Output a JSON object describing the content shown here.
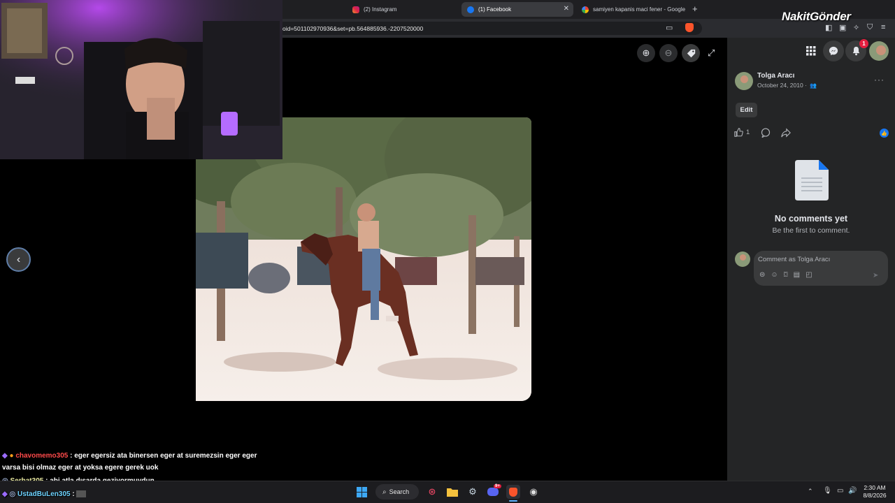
{
  "browser": {
    "tabs": [
      {
        "title": "(2) Instagram",
        "icon": "instagram-icon",
        "active": false
      },
      {
        "title": "(1) Facebook",
        "icon": "facebook-icon",
        "active": true
      },
      {
        "title": "samiyen kapanis maci fener - Google",
        "icon": "google-icon",
        "active": false
      }
    ],
    "new_tab": "+",
    "url": "oid=501102970936&set=pb.564885936.-2207520000"
  },
  "watermark": "NakitGönder",
  "viewer": {
    "controls": [
      "zoom-in-icon",
      "zoom-out-icon",
      "tag-icon",
      "fullscreen-icon"
    ]
  },
  "panel": {
    "author": "Tolga Aracı",
    "date": "October 24, 2010 ·",
    "edit_label": "Edit",
    "like_count": "1",
    "no_comments_title": "No comments yet",
    "no_comments_sub": "Be the first to comment.",
    "comment_placeholder": "Comment as Tolga Aracı",
    "notifications_badge": "1"
  },
  "chat": [
    {
      "user": "chavomemo305",
      "user_color": "#ff4a4a",
      "message": ": eger egersiz ata binersen eger at suremezsin eger eger",
      "continued": "varsa bisi olmaz eger at yoksa egere gerek uok"
    },
    {
      "user": "Serhat305",
      "user_color": "#e8e8a0",
      "message": ": abi atla dışarda geziyormuydun"
    },
    {
      "user": "UstadBuLen305",
      "user_color": "#6fd3ff",
      "message": ":"
    }
  ],
  "taskbar": {
    "search_label": "Search",
    "discord_badge": "9+",
    "time": "2:30 AM",
    "date": "8/8/2026"
  },
  "colors": {
    "facebook_blue": "#1877f2",
    "panel_bg": "#242526",
    "notification_red": "#e41e3f"
  }
}
